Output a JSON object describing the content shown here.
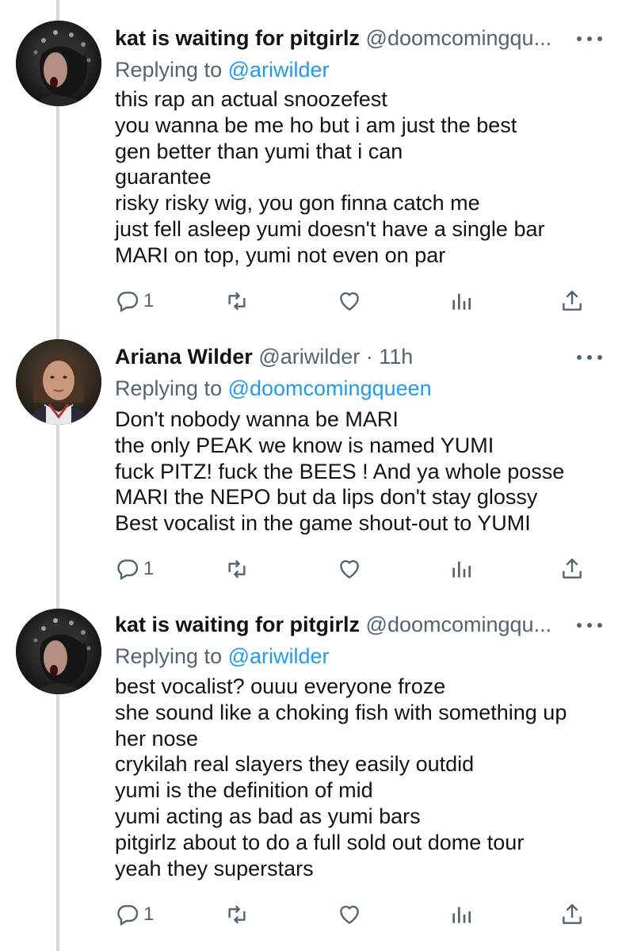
{
  "tweets": [
    {
      "name": "kat is waiting for pitgirlz",
      "handle": "@doomcomingqu...",
      "time": "",
      "replying_prefix": "Replying to ",
      "replying_to": "@ariwilder",
      "lines": [
        "this rap an actual snoozefest",
        "you wanna be me ho but i am just the best",
        "gen better than yumi that i can",
        "guarantee",
        "risky risky wig, you gon finna catch me",
        "just fell asleep yumi doesn't have a single bar",
        "MARI on top, yumi not even on par"
      ],
      "reply_count": "1",
      "avatar_icon": "dark-portrait-avatar"
    },
    {
      "name": "Ariana Wilder",
      "handle": "@ariwilder",
      "time": "· 11h",
      "replying_prefix": "Replying to ",
      "replying_to": "@doomcomingqueen",
      "lines": [
        "Don't nobody wanna be MARI",
        "the only PEAK we know is named YUMI",
        "fuck PITZ! fuck the BEES ! And ya whole posse",
        "MARI the NEPO but da lips don't stay glossy",
        "Best vocalist in the game shout-out to YUMI"
      ],
      "reply_count": "1",
      "avatar_icon": "woman-portrait-avatar"
    },
    {
      "name": "kat is waiting for pitgirlz",
      "handle": "@doomcomingqu...",
      "time": "",
      "replying_prefix": "Replying to ",
      "replying_to": "@ariwilder",
      "lines": [
        "best vocalist? ouuu everyone froze",
        "she sound like a choking fish with something up",
        "her nose",
        "crykilah real slayers they easily outdid",
        "yumi is the definition of mid",
        "yumi acting as bad as yumi bars",
        "pitgirlz about to do a full sold out dome tour",
        "yeah they superstars"
      ],
      "reply_count": "1",
      "avatar_icon": "dark-portrait-avatar"
    }
  ],
  "colors": {
    "text": "#0f1419",
    "secondary": "#536471",
    "link": "#1d9bf0",
    "thread_line": "#cfd9de"
  },
  "action_icons": [
    "reply-icon",
    "retweet-icon",
    "like-icon",
    "analytics-icon",
    "share-icon"
  ]
}
